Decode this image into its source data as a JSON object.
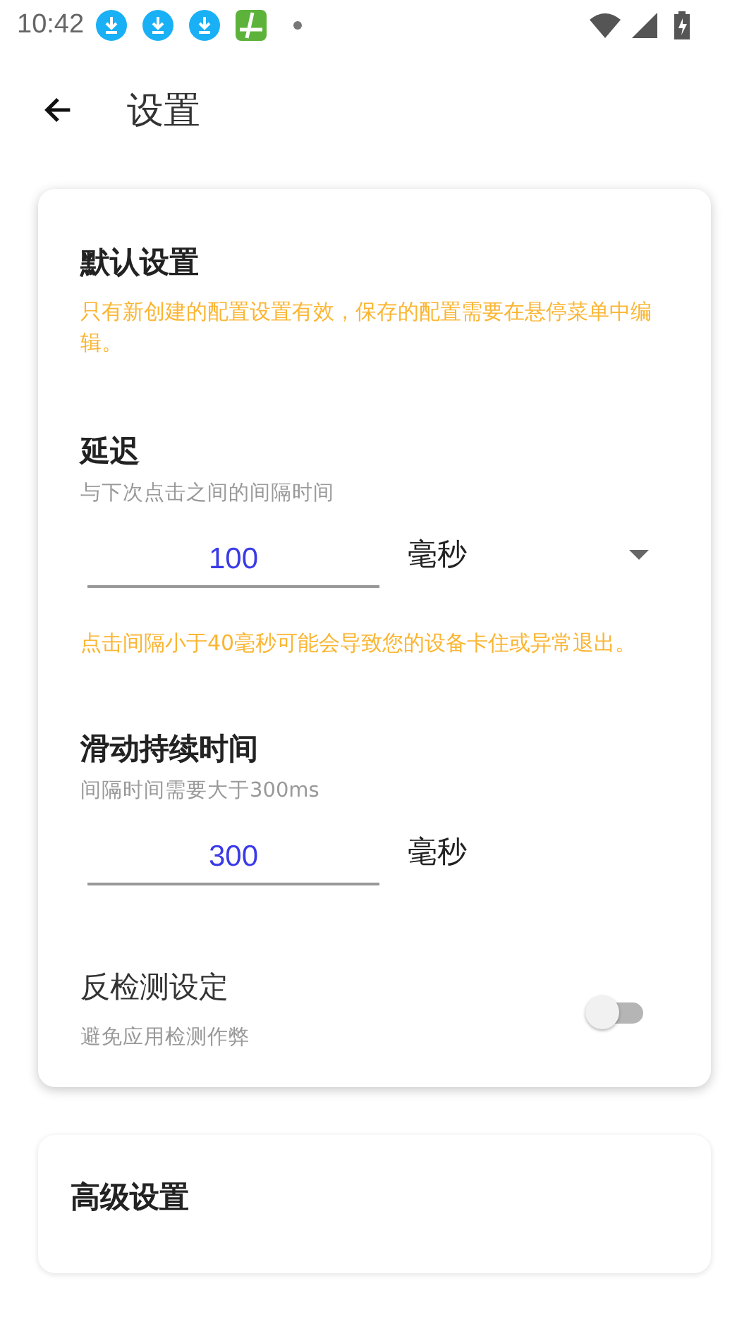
{
  "status_bar": {
    "time": "10:42"
  },
  "header": {
    "title": "设置"
  },
  "default_card": {
    "title": "默认设置",
    "notice": "只有新创建的配置设置有效，保存的配置需要在悬停菜单中编辑。",
    "settings": [
      {
        "kind": "duration",
        "label": "延迟",
        "hint": "与下次点击之间的间隔时间",
        "value": "100",
        "unit": "毫秒",
        "unit_dropdown": true,
        "warning": "点击间隔小于40毫秒可能会导致您的设备卡住或异常退出。"
      },
      {
        "kind": "duration",
        "label": "滑动持续时间",
        "hint": "间隔时间需要大于300ms",
        "value": "300",
        "unit": "毫秒",
        "unit_dropdown": false
      },
      {
        "kind": "switch",
        "label": "反检测设定",
        "hint": "避免应用检测作弊",
        "on": false
      }
    ]
  },
  "advanced_card": {
    "title": "高级设置"
  }
}
